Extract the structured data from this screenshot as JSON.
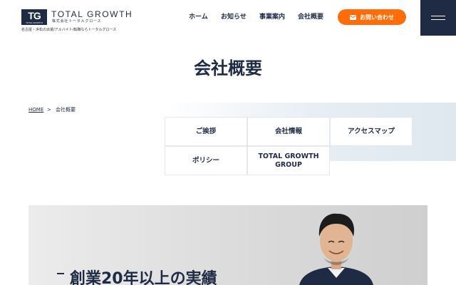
{
  "header": {
    "logo_mark": "TG",
    "logo_mark_sub": "TOTAL GROWTH",
    "logo_name": "TOTAL GROWTH",
    "logo_kana": "株式会社トータルグロース",
    "tagline": "名古屋・浜松の派遣/アルバイト/転職ならトータルグロース",
    "nav": [
      "ホーム",
      "お知らせ",
      "事業案内",
      "会社概要"
    ],
    "contact_label": "お問い合わせ",
    "contact_icon": "mail-icon",
    "menu_icon": "hamburger-icon",
    "accent_color": "#ff6d0a",
    "brand_color": "#1f2a44"
  },
  "page": {
    "title": "会社概要"
  },
  "breadcrumb": {
    "home": "HOME",
    "separator": ">",
    "current": "会社概要"
  },
  "tabs": [
    "ご挨拶",
    "会社情報",
    "アクセスマップ",
    "ポリシー",
    "TOTAL GROWTH GROUP"
  ],
  "hero": {
    "text": "創業20年以上の実績"
  }
}
